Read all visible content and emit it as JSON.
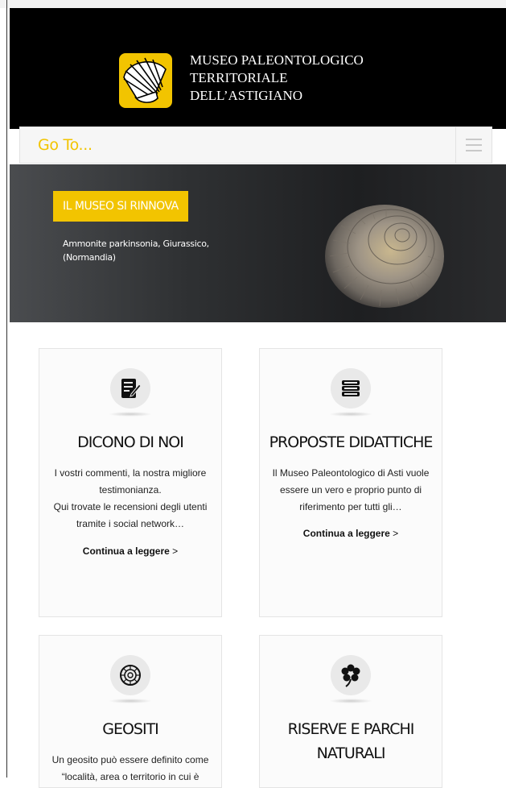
{
  "header": {
    "logo_lines": [
      "MUSEO PALEONTOLOGICO",
      "TERRITORIALE",
      "DELL’ASTIGIANO"
    ]
  },
  "nav": {
    "label": "Go To...",
    "menu_icon": "hamburger-icon"
  },
  "hero": {
    "badge": "IL MUSEO SI RINNOVA",
    "caption_lines": [
      "Ammonite parkinsonia, Giurassico,",
      "(Normandia)"
    ]
  },
  "cards": [
    {
      "icon": "document-pen-icon",
      "title": "DICONO DI NOI",
      "text_lines": [
        "I vostri commenti, la nostra migliore",
        "testimonianza.",
        "Qui trovate le recensioni degli utenti",
        "tramite i social network…"
      ],
      "link": "Continua a leggere",
      "link_arrow": ">"
    },
    {
      "icon": "books-icon",
      "title": "PROPOSTE DIDATTICHE",
      "text_lines": [
        "Il Museo Paleontologico di Asti vuole",
        "essere un vero e proprio punto di",
        "riferimento per tutti gli…"
      ],
      "link": "Continua a leggere",
      "link_arrow": ">"
    },
    {
      "icon": "fossil-shell-icon",
      "title": "GEOSITI",
      "text_lines": [
        "Un geosito può essere definito come",
        "“località, area o territorio in cui è"
      ]
    },
    {
      "icon": "flower-icon",
      "title_lines": [
        "RISERVE E PARCHI",
        "NATURALI"
      ]
    }
  ],
  "colors": {
    "accent": "#f2c400",
    "header_bg": "#000000",
    "nav_bg": "#f6f6f6"
  }
}
